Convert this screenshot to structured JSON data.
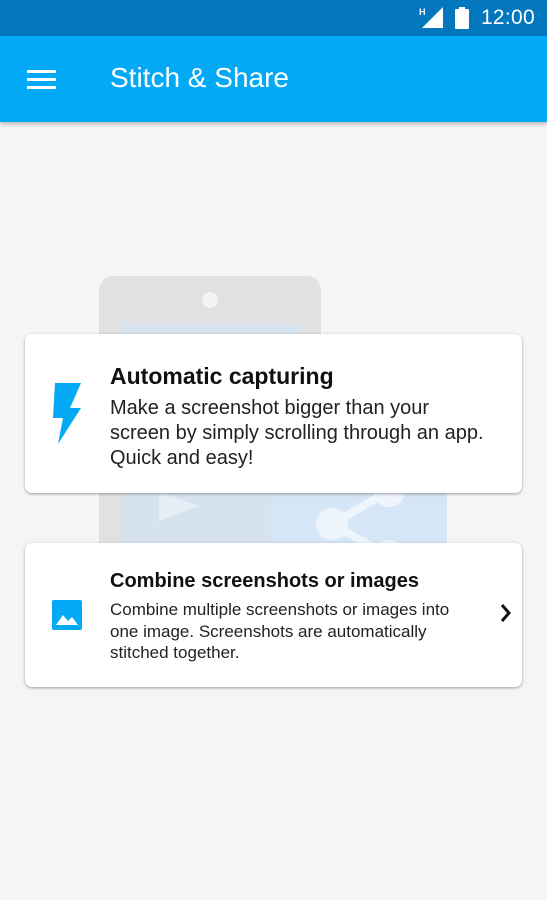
{
  "status_bar": {
    "network_type": "H",
    "time": "12:00",
    "icons": [
      "cell-signal-icon",
      "battery-icon"
    ]
  },
  "app_bar": {
    "title": "Stitch & Share",
    "menu_icon": "hamburger-menu-icon"
  },
  "cards": [
    {
      "title": "Automatic capturing",
      "description": "Make a screenshot bigger than your screen by simply scrolling through an app. Quick and easy!",
      "icon": "lightning-bolt-icon"
    },
    {
      "title": "Combine screenshots or images",
      "description": "Combine multiple screenshots or images into one image. Screenshots are automatically stitched together.",
      "icon": "image-icon",
      "trailing_icon": "chevron-right-icon"
    }
  ],
  "colors": {
    "status_bar": "#0277bd",
    "app_bar": "#03a9f4",
    "accent": "#03a9f4",
    "background": "#f5f5f5"
  }
}
